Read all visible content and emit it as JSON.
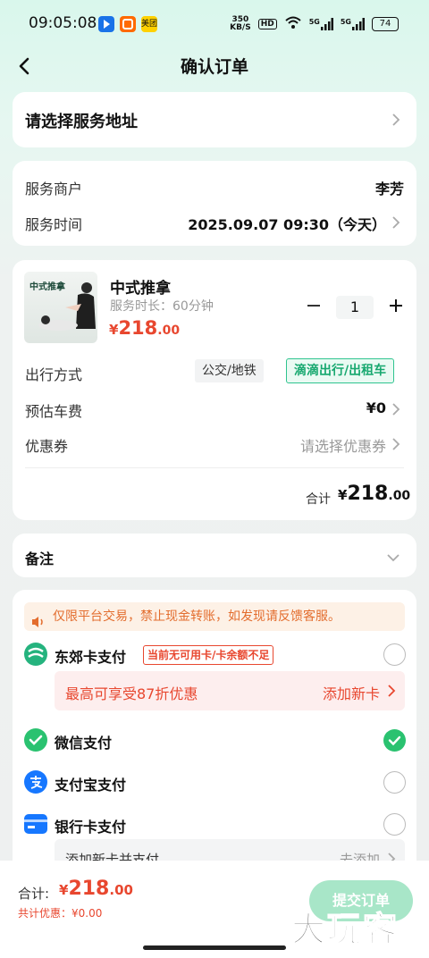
{
  "status_bar": {
    "time": "09:05:08",
    "app_icons": [
      {
        "label": "",
        "color": "#1a73e8"
      },
      {
        "label": "",
        "color": "#ff6a00"
      },
      {
        "label": "美团",
        "color": "#ffd100"
      }
    ],
    "net_speed": "350\nKB/S",
    "hd": "HD",
    "signal_1": "5G",
    "signal_2": "5G",
    "battery": "74"
  },
  "nav": {
    "title": "确认订单"
  },
  "address": {
    "prompt": "请选择服务地址"
  },
  "merchant": {
    "merchant_label": "服务商户",
    "merchant_value": "李芳",
    "time_label": "服务时间",
    "time_value": "2025.09.07 09:30（今天）"
  },
  "service": {
    "thumb_text": "中式推拿",
    "name": "中式推拿",
    "duration": "服务时长：60分钟",
    "price_yen": "¥",
    "price_int": "218",
    "price_dec": ".00",
    "quantity": "1",
    "travel_label": "出行方式",
    "travel_options": [
      "公交/地铁",
      "滴滴出行/出租车"
    ],
    "fare_label": "预估车费",
    "fare_value": "¥0",
    "coupon_label": "优惠券",
    "coupon_value": "请选择优惠券",
    "total_label": "合计",
    "total_yen": "¥",
    "total_int": "218",
    "total_dec": ".00"
  },
  "remark": {
    "label": "备注"
  },
  "payment": {
    "notice": "仅限平台交易，禁止现金转账，如发现请反馈客服。",
    "methods": [
      {
        "label": "东郊卡支付",
        "selected": false,
        "tag": "当前无可用卡/卡余额不足"
      },
      {
        "label": "微信支付",
        "selected": true
      },
      {
        "label": "支付宝支付",
        "selected": false
      },
      {
        "label": "银行卡支付",
        "selected": false
      }
    ],
    "promo_text": "最高可享受87折优惠",
    "promo_action": "添加新卡",
    "bank_sub_text": "添加新卡并支付",
    "bank_sub_action": "去添加"
  },
  "bottom": {
    "total_label": "合计:",
    "total_yen": "¥",
    "total_int": "218",
    "total_dec": ".00",
    "discount": "共计优惠：¥0.00",
    "submit": "提交订单",
    "watermark": "大玩客"
  },
  "colors": {
    "accent_green": "#2ac270",
    "price_red": "#e8472f",
    "notice_orange": "#e36d2e"
  }
}
